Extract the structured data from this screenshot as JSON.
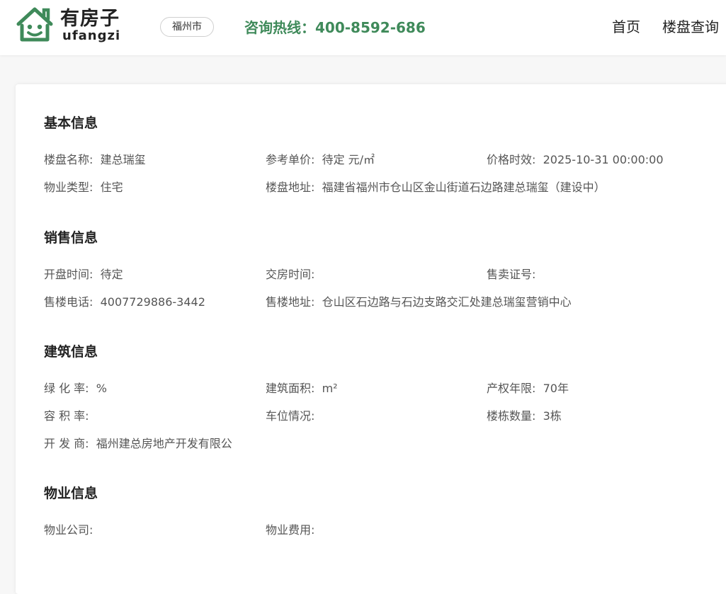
{
  "header": {
    "logo_cn": "有房子",
    "logo_en": "ufangzi",
    "city": "福州市",
    "hotline": "咨询热线：400-8592-686",
    "nav": {
      "home": "首页",
      "search": "楼盘查询"
    },
    "brand_color": "#3f8a5a"
  },
  "sections": {
    "basic": {
      "title": "基本信息",
      "name_label": "楼盘名称:",
      "name_value": "建总瑞玺",
      "price_label": "参考单价:",
      "price_value": "待定 元/㎡",
      "price_time_label": "价格时效:",
      "price_time_value": "2025-10-31 00:00:00",
      "type_label": "物业类型:",
      "type_value": "住宅",
      "address_label": "楼盘地址:",
      "address_value": "福建省福州市仓山区金山街道石边路建总瑞玺（建设中）"
    },
    "sales": {
      "title": "销售信息",
      "open_label": "开盘时间:",
      "open_value": "待定",
      "delivery_label": "交房时间:",
      "delivery_value": "",
      "license_label": "售卖证号:",
      "license_value": "",
      "phone_label": "售楼电话:",
      "phone_value": "4007729886-3442",
      "office_label": "售楼地址:",
      "office_value": "仓山区石边路与石边支路交汇处建总瑞玺营销中心"
    },
    "building": {
      "title": "建筑信息",
      "green_label": "绿 化 率:",
      "green_value": "%",
      "area_label": "建筑面积:",
      "area_value": "m²",
      "term_label": "产权年限:",
      "term_value": "70年",
      "far_label": "容 积 率:",
      "far_value": "",
      "parking_label": "车位情况:",
      "parking_value": "",
      "count_label": "楼栋数量:",
      "count_value": "3栋",
      "dev_label": "开 发 商:",
      "dev_value": "福州建总房地产开发有限公"
    },
    "property": {
      "title": "物业信息",
      "company_label": "物业公司:",
      "company_value": "",
      "fee_label": "物业费用:",
      "fee_value": ""
    }
  }
}
